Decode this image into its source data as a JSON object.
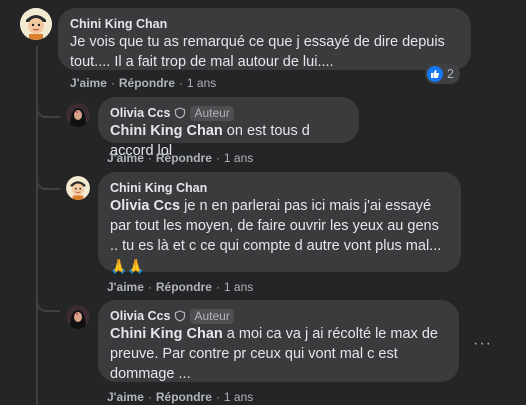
{
  "comments": [
    {
      "author": "Chini King Chan",
      "lines": [
        "Je vois que tu as remarqué ce que j essayé de dire depuis",
        "tout.... Il a fait trop de mal autour de lui...."
      ],
      "like": "J'aime",
      "reply": "Répondre",
      "time": "1 ans",
      "reaction_count": "2"
    },
    {
      "author": "Olivia Ccs",
      "badge": "Auteur",
      "mention": "Chini King Chan",
      "text": " on est tous d accord lol",
      "like": "J'aime",
      "reply": "Répondre",
      "time": "1 ans"
    },
    {
      "author": "Chini King Chan",
      "mention": "Olivia Ccs",
      "line1": " je n en parlerai pas ici mais j'ai essayé",
      "line2": "par tout les moyen, de faire ouvrir les yeux au gens",
      "line3": ".. tu es là et c ce qui compte d autre vont plus mal...",
      "emoji": "🙏🙏",
      "like": "J'aime",
      "reply": "Répondre",
      "time": "1 ans"
    },
    {
      "author": "Olivia Ccs",
      "badge": "Auteur",
      "mention": "Chini King Chan",
      "line1": " a moi ca va j ai récolté le max de",
      "line2": "preuve. Par contre pr ceux qui vont mal c est",
      "line3": "dommage ...",
      "like": "J'aime",
      "reply": "Répondre",
      "time": "1 ans"
    }
  ],
  "dot": "·",
  "colors": {
    "background": "#242526",
    "bubble": "#3a3b3c",
    "like": "#1877f2"
  },
  "icons": [
    "avatar-cartoon-icon",
    "avatar-photo-icon",
    "shield-icon",
    "like-icon",
    "more-options-icon"
  ]
}
